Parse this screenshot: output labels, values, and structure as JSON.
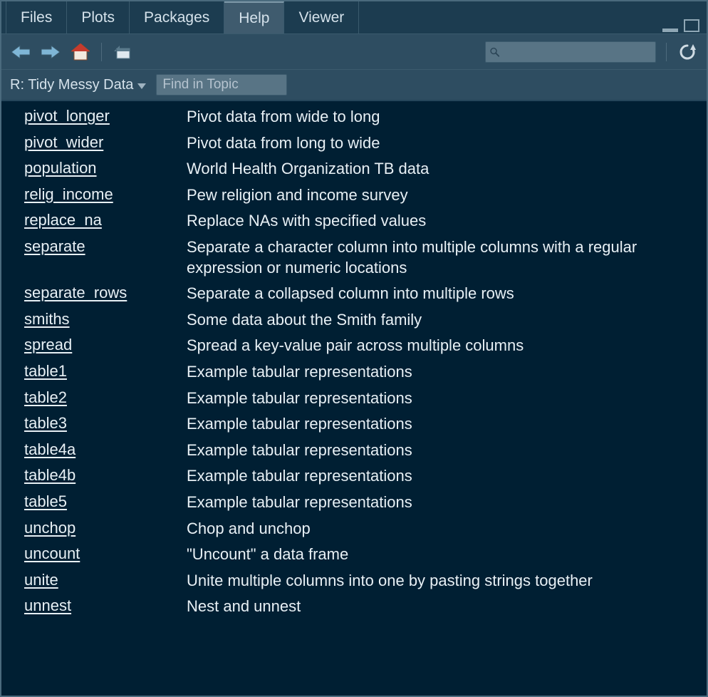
{
  "tabs": [
    {
      "label": "Files",
      "active": false
    },
    {
      "label": "Plots",
      "active": false
    },
    {
      "label": "Packages",
      "active": false
    },
    {
      "label": "Help",
      "active": true
    },
    {
      "label": "Viewer",
      "active": false
    }
  ],
  "breadcrumb": "R: Tidy Messy Data",
  "find_placeholder": "Find in Topic",
  "search_placeholder": "",
  "topics": [
    {
      "fn": "pivot_longer",
      "desc": "Pivot data from wide to long"
    },
    {
      "fn": "pivot_wider",
      "desc": "Pivot data from long to wide"
    },
    {
      "fn": "population",
      "desc": "World Health Organization TB data"
    },
    {
      "fn": "relig_income",
      "desc": "Pew religion and income survey"
    },
    {
      "fn": "replace_na",
      "desc": "Replace NAs with specified values"
    },
    {
      "fn": "separate",
      "desc": "Separate a character column into multiple columns with a regular expression or numeric locations"
    },
    {
      "fn": "separate_rows",
      "desc": "Separate a collapsed column into multiple rows"
    },
    {
      "fn": "smiths",
      "desc": "Some data about the Smith family"
    },
    {
      "fn": "spread",
      "desc": "Spread a key-value pair across multiple columns"
    },
    {
      "fn": "table1",
      "desc": "Example tabular representations"
    },
    {
      "fn": "table2",
      "desc": "Example tabular representations"
    },
    {
      "fn": "table3",
      "desc": "Example tabular representations"
    },
    {
      "fn": "table4a",
      "desc": "Example tabular representations"
    },
    {
      "fn": "table4b",
      "desc": "Example tabular representations"
    },
    {
      "fn": "table5",
      "desc": "Example tabular representations"
    },
    {
      "fn": "unchop",
      "desc": "Chop and unchop"
    },
    {
      "fn": "uncount",
      "desc": "\"Uncount\" a data frame"
    },
    {
      "fn": "unite",
      "desc": "Unite multiple columns into one by pasting strings together"
    },
    {
      "fn": "unnest",
      "desc": "Nest and unnest"
    }
  ]
}
